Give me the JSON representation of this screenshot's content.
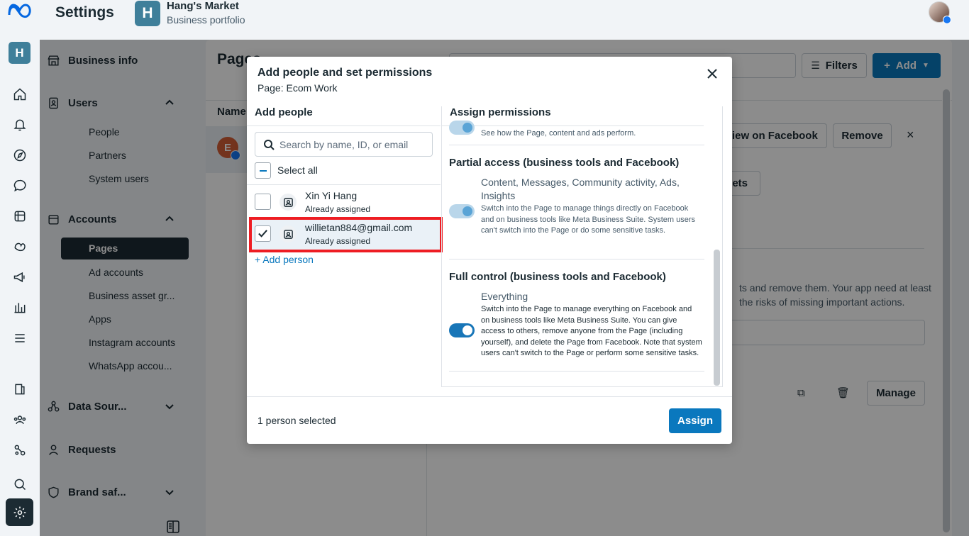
{
  "app": {
    "title": "Settings",
    "portfolio_initial": "H",
    "portfolio_name": "Hang's Market",
    "portfolio_type": "Business portfolio",
    "rail_initial": "H"
  },
  "sidebar": {
    "business_info": "Business info",
    "users": "Users",
    "users_items": [
      "People",
      "Partners",
      "System users"
    ],
    "accounts": "Accounts",
    "accounts_items": [
      "Pages",
      "Ad accounts",
      "Business asset gr...",
      "Apps",
      "Instagram accounts",
      "WhatsApp accou..."
    ],
    "data_sources": "Data Sour...",
    "requests": "Requests",
    "brand_safety": "Brand saf..."
  },
  "main": {
    "title": "Pages",
    "col_name": "Name",
    "row_initial": "E",
    "filters": "Filters",
    "add": "Add",
    "view_on_facebook": "View on Facebook",
    "remove": "Remove",
    "assets": "sets",
    "desc_line1": "ts and remove them. Your app need at least",
    "desc_line2": "the risks of missing important actions.",
    "manage": "Manage"
  },
  "modal": {
    "title": "Add people and set permissions",
    "subtitle": "Page: Ecom Work",
    "add_people": "Add people",
    "search_placeholder": "Search by name, ID, or email",
    "select_all": "Select all",
    "people": [
      {
        "name": "Xin Yi Hang",
        "status": "Already assigned",
        "checked": false
      },
      {
        "name": "willietan884@gmail.com",
        "status": "Already assigned",
        "checked": true
      }
    ],
    "add_person": "+ Add person",
    "assign_permissions": "Assign permissions",
    "partial_line": "See how the Page, content and ads perform.",
    "partial_title": "Partial access (business tools and Facebook)",
    "partial_perm_title": "Content, Messages, Community activity, Ads, Insights",
    "partial_perm_desc": "Switch into the Page to manage things directly on Facebook and on business tools like Meta Business Suite. System users can't switch into the Page or do some sensitive tasks.",
    "full_title": "Full control (business tools and Facebook)",
    "full_perm_title": "Everything",
    "full_perm_desc": "Switch into the Page to manage everything on Facebook and on business tools like Meta Business Suite. You can give access to others, remove anyone from the Page (including yourself), and delete the Page from Facebook. Note that system users can't switch to the Page or perform some sensitive tasks.",
    "selected_count": "1 person selected",
    "assign": "Assign"
  },
  "colors": {
    "brand_blue": "#0a78be",
    "dark": "#1c2b33",
    "highlight": "#ee1d23"
  }
}
